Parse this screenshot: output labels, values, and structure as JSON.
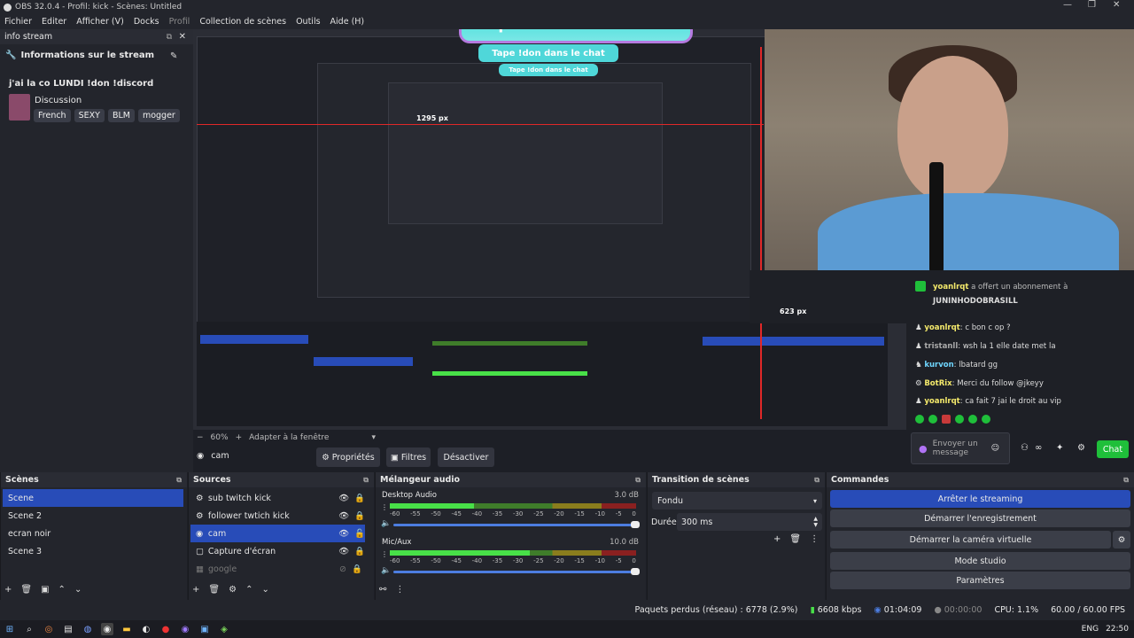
{
  "window": {
    "title": "OBS 32.0.4 - Profil: kick - Scènes: Untitled",
    "min": "—",
    "max": "❐",
    "close": "✕"
  },
  "menu": [
    "Fichier",
    "Editer",
    "Afficher (V)",
    "Docks",
    "Profil",
    "Collection de scènes",
    "Outils",
    "Aide (H)"
  ],
  "info_dock": {
    "title": "info stream",
    "header": "Informations sur le stream",
    "stream_title": "j'ai la co LUNDI !don !discord",
    "category": "Discussion",
    "tags": [
      "French",
      "SEXY",
      "BLM",
      "mogger"
    ]
  },
  "overlay": {
    "banner": "Tape !don dans le chat",
    "measure": "1295 px",
    "measure2": "623 px"
  },
  "chat": {
    "sub_user": "yoanlrqt",
    "sub_text": "a offert un abonnement à",
    "sub_target": "JUNINHODOBRASILL",
    "messages": [
      {
        "user": "yoanlrqt",
        "text": "c bon c op ?",
        "color": "#f4e96b"
      },
      {
        "user": "tristanll",
        "text": "wsh la 1 elle date met la",
        "color": "#f4e96b"
      },
      {
        "user": "kurvon",
        "text": "lbatard gg",
        "color": "#6fd6ff"
      },
      {
        "user": "BotRix",
        "text": "Merci du follow @jkeyy",
        "color": "#f4e96b"
      },
      {
        "user": "yoanlrqt",
        "text": "ca fait 7 jai le droit au vip",
        "color": "#f4e96b"
      }
    ],
    "input_placeholder": "Envoyer un message",
    "chat_button": "Chat"
  },
  "preview_controls": {
    "zoom": "60%",
    "fit": "Adapter à la fenêtre",
    "source_name": "cam",
    "properties": "Propriétés",
    "filters": "Filtres",
    "deactivate": "Désactiver"
  },
  "scenes": {
    "title": "Scènes",
    "items": [
      "Scene",
      "Scene 2",
      "ecran noir",
      "Scene 3"
    ],
    "selected": 0
  },
  "sources": {
    "title": "Sources",
    "items": [
      {
        "name": "sub twitch kick",
        "icon": "⚙"
      },
      {
        "name": "follower twtich kick",
        "icon": "⚙"
      },
      {
        "name": "cam",
        "icon": "📷"
      },
      {
        "name": "Capture d'écran",
        "icon": "▢"
      },
      {
        "name": "google",
        "icon": "▦"
      }
    ],
    "selected": 2
  },
  "mixer": {
    "title": "Mélangeur audio",
    "channels": [
      {
        "name": "Desktop Audio",
        "db": "3.0 dB",
        "level": 0.34,
        "volume": 1.0
      },
      {
        "name": "Mic/Aux",
        "db": "10.0 dB",
        "level": 0.57,
        "volume": 1.0
      }
    ],
    "ticks": [
      "-60",
      "-55",
      "-50",
      "-45",
      "-40",
      "-35",
      "-30",
      "-25",
      "-20",
      "-15",
      "-10",
      "-5",
      "0"
    ]
  },
  "transition": {
    "title": "Transition de scènes",
    "type": "Fondu",
    "duration_label": "Durée",
    "duration": "300 ms"
  },
  "commands": {
    "title": "Commandes",
    "buttons": [
      "Arrêter le streaming",
      "Démarrer l'enregistrement",
      "Démarrer la caméra virtuelle",
      "Mode studio",
      "Paramètres"
    ]
  },
  "status": {
    "dropped": "Paquets perdus (réseau) : 6778 (2.9%)",
    "bitrate": "6608 kbps",
    "stream_time": "01:04:09",
    "rec_time": "00:00:00",
    "cpu": "CPU: 1.1%",
    "fps": "60.00 / 60.00 FPS"
  },
  "taskbar": {
    "lang": "ENG",
    "clock": "22:50"
  },
  "colors": {
    "accent": "#284cb8",
    "background": "#1d1f26",
    "panel": "#23252c",
    "chat_green": "#1fbf3a"
  }
}
